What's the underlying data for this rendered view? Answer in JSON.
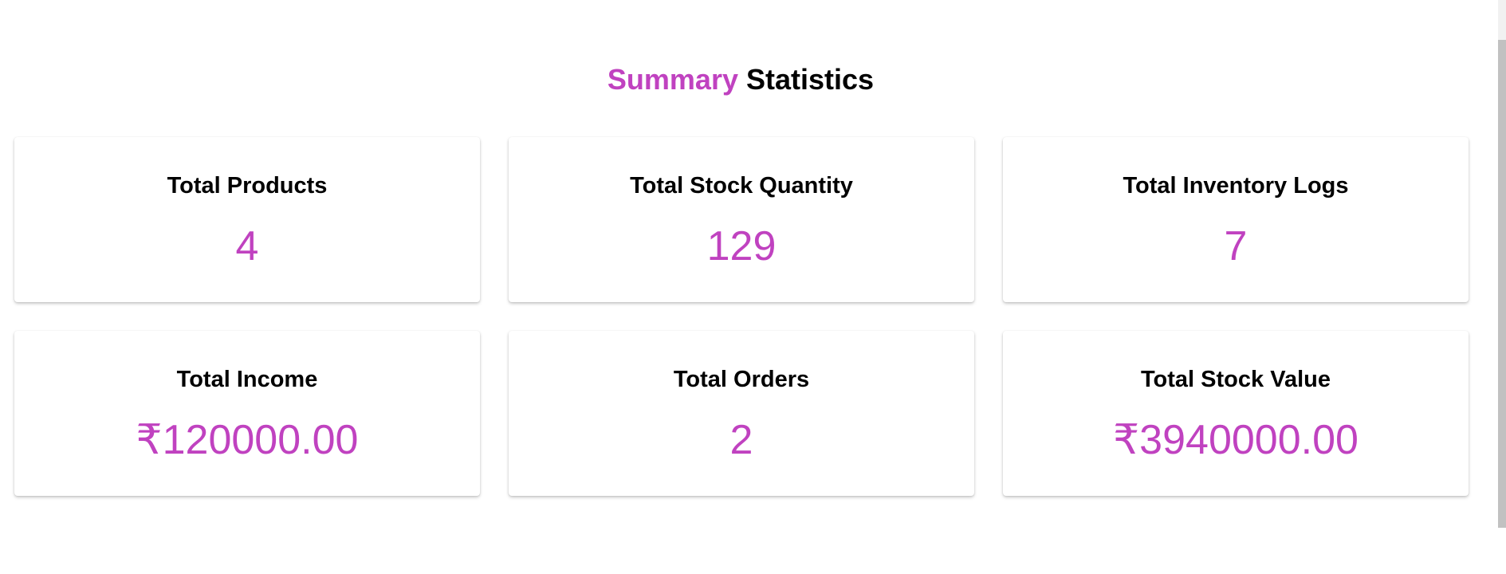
{
  "heading": {
    "accent": "Summary",
    "rest": "Statistics"
  },
  "accent_color": "#c042c0",
  "cards": [
    {
      "title": "Total Products",
      "value": "4"
    },
    {
      "title": "Total Stock Quantity",
      "value": "129"
    },
    {
      "title": "Total Inventory Logs",
      "value": "7"
    },
    {
      "title": "Total Income",
      "value": "₹120000.00"
    },
    {
      "title": "Total Orders",
      "value": "2"
    },
    {
      "title": "Total Stock Value",
      "value": "₹3940000.00"
    }
  ]
}
